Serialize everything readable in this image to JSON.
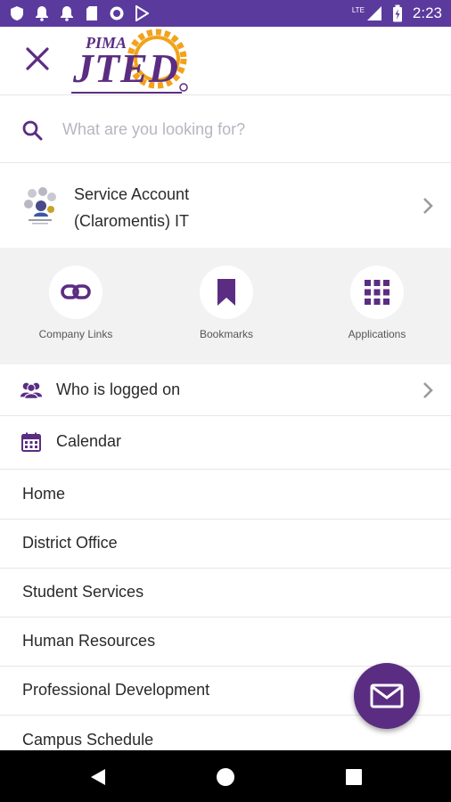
{
  "status_bar": {
    "time": "2:23",
    "network": "LTE"
  },
  "header": {
    "logo_top": "PIMA",
    "logo_main": "JTED"
  },
  "search": {
    "placeholder": "What are you looking for?"
  },
  "account": {
    "line1": "Service Account",
    "line2": "(Claromentis) IT"
  },
  "quick_links": [
    {
      "label": "Company Links",
      "icon": "link-icon"
    },
    {
      "label": "Bookmarks",
      "icon": "bookmark-icon"
    },
    {
      "label": "Applications",
      "icon": "grid-icon"
    }
  ],
  "menu": {
    "who_logged_on": "Who is logged on",
    "calendar": "Calendar",
    "items": [
      "Home",
      "District Office",
      "Student Services",
      "Human Resources",
      "Professional Development",
      "Campus Schedule"
    ]
  },
  "colors": {
    "accent": "#5b2d82",
    "status_bar": "#5b3a9e",
    "logo_orange": "#f2a21b"
  }
}
